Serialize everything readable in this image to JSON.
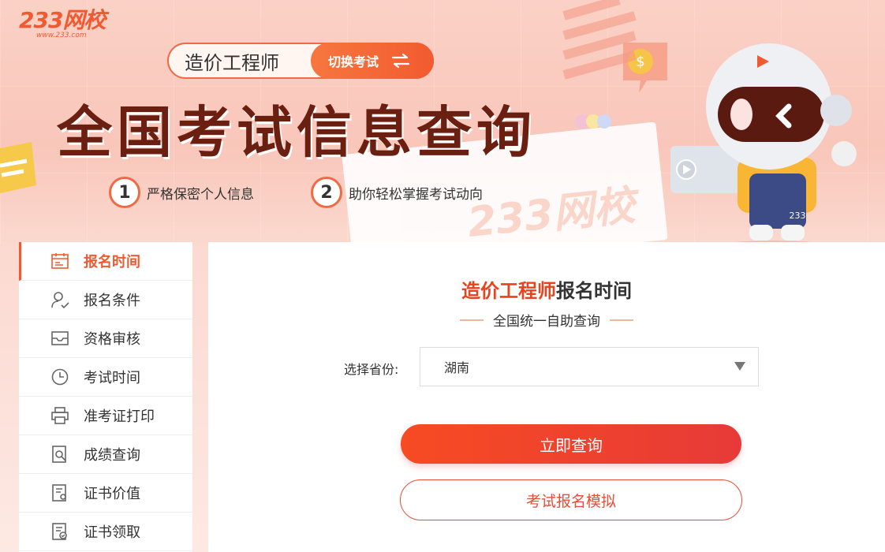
{
  "logo": {
    "main": "233网校",
    "sub": "www.233.com",
    "watermark": "233网校"
  },
  "header": {
    "exam_name": "造价工程师",
    "switch_label": "切换考试",
    "title": "全国考试信息查询",
    "features": [
      {
        "num": "1",
        "text": "严格保密个人信息"
      },
      {
        "num": "2",
        "text": "助你轻松掌握考试动向"
      }
    ]
  },
  "sidebar": {
    "items": [
      {
        "label": "报名时间",
        "icon": "calendar-icon",
        "active": true
      },
      {
        "label": "报名条件",
        "icon": "user-check-icon",
        "active": false
      },
      {
        "label": "资格审核",
        "icon": "inbox-icon",
        "active": false
      },
      {
        "label": "考试时间",
        "icon": "clock-icon",
        "active": false
      },
      {
        "label": "准考证打印",
        "icon": "printer-icon",
        "active": false
      },
      {
        "label": "成绩查询",
        "icon": "search-doc-icon",
        "active": false
      },
      {
        "label": "证书价值",
        "icon": "certificate-icon",
        "active": false
      },
      {
        "label": "证书领取",
        "icon": "certificate-check-icon",
        "active": false
      }
    ]
  },
  "main": {
    "title_highlight": "造价工程师",
    "title_rest": "报名时间",
    "subtitle": "全国统一自助查询",
    "province_label": "选择省份:",
    "province_value": "湖南",
    "query_button": "立即查询",
    "simulate_button": "考试报名模拟"
  },
  "colors": {
    "accent": "#f15a30",
    "primary_button": "#f74b23",
    "title_dark": "#6a1f10"
  }
}
